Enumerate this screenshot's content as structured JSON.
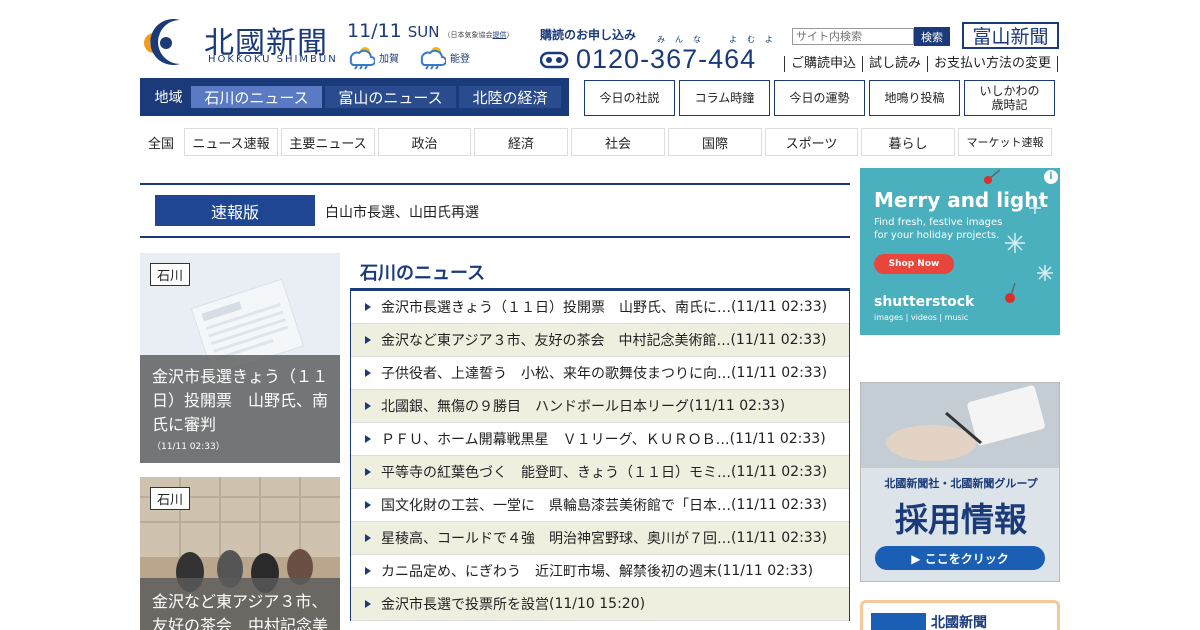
{
  "header": {
    "brand": "北國新聞",
    "brand_romaji": "HOKKOKU SHIMBUN",
    "date": "11/11",
    "weekday": "SUN",
    "weather_credit_prefix": "（日本気象協会",
    "weather_credit_link": "提供",
    "weather_credit_suffix": "）",
    "weather": [
      {
        "region": "加賀",
        "icon": "cloud-sun-rain-icon"
      },
      {
        "region": "能登",
        "icon": "cloud-sun-rain-icon"
      }
    ],
    "subscribe_label": "購読のお申し込み",
    "phone_furigana": "みんな　よむよ",
    "phone_number": "0120-367-464",
    "search_placeholder": "サイト内検索",
    "search_button": "検索",
    "toyama_logo": "富山新聞",
    "util_links": [
      "ご購読申込",
      "試し読み",
      "お支払い方法の変更"
    ]
  },
  "region_nav": {
    "label": "地域",
    "tabs": [
      "石川のニュース",
      "富山のニュース",
      "北陸の経済"
    ],
    "active": 0
  },
  "box_buttons": [
    {
      "label": "今日の社説"
    },
    {
      "label": "コラム時鐘"
    },
    {
      "label": "今日の運勢"
    },
    {
      "label": "地鳴り投稿"
    },
    {
      "label": "いしかわの",
      "label2": "歳時記"
    }
  ],
  "category_nav": {
    "all_label": "全国",
    "items": [
      "ニュース速報",
      "主要ニュース",
      "政治",
      "経済",
      "社会",
      "国際",
      "スポーツ",
      "暮らし",
      "マーケット速報"
    ]
  },
  "breaking": {
    "label": "速報版",
    "text": "白山市長選、山田氏再選"
  },
  "features": [
    {
      "tag": "石川",
      "title": "金沢市長選きょう（１１日）投開票　山野氏、南氏に審判",
      "time": "（11/11 02:33）"
    },
    {
      "tag": "石川",
      "title": "金沢など東アジア３市、友好の茶会　中村記念美",
      "time": ""
    }
  ],
  "news": {
    "title": "石川のニュース",
    "items": [
      {
        "text": "金沢市長選きょう（１１日）投開票　山野氏、南氏に…",
        "time": "(11/11 02:33)"
      },
      {
        "text": "金沢など東アジア３市、友好の茶会　中村記念美術館…",
        "time": "(11/11 02:33)"
      },
      {
        "text": "子供役者、上達誓う　小松、来年の歌舞伎まつりに向…",
        "time": "(11/11 02:33)"
      },
      {
        "text": "北國銀、無傷の９勝目　ハンドボール日本リーグ",
        "time": "(11/11 02:33)"
      },
      {
        "text": "ＰＦＵ、ホーム開幕戦黒星　Ｖ１リーグ、ＫＵＲＯＢ…",
        "time": "(11/11 02:33)"
      },
      {
        "text": "平等寺の紅葉色づく　能登町、きょう（１１日）モミ…",
        "time": "(11/11 02:33)"
      },
      {
        "text": "国文化財の工芸、一堂に　県輪島漆芸美術館で「日本…",
        "time": "(11/11 02:33)"
      },
      {
        "text": "星稜高、コールドで４強　明治神宮野球、奥川が７回…",
        "time": "(11/11 02:33)"
      },
      {
        "text": "カニ品定め、にぎわう　近江町市場、解禁後初の週末",
        "time": "(11/11 02:33)"
      },
      {
        "text": "金沢市長選で投票所を設営",
        "time": "(11/10 15:20)"
      }
    ]
  },
  "ads": {
    "shutterstock": {
      "headline": "Merry and light",
      "sub": "Find fresh, festive images for your holiday projects.",
      "cta": "Shop Now",
      "brand": "shutterstock",
      "tagline": "images | videos | music",
      "info": "i"
    },
    "recruit": {
      "line1": "北國新聞社・北國新聞グループ",
      "line2": "採用情報",
      "cta": "▶ ここをクリック"
    },
    "bottom": {
      "title": "北國新聞"
    }
  }
}
